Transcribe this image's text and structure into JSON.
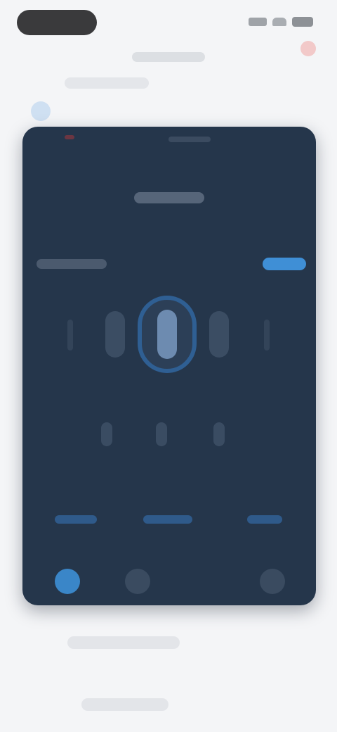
{
  "status_bar": {
    "icons": [
      "signal-icon",
      "wifi-icon",
      "battery-icon"
    ]
  },
  "header": {
    "title": "",
    "action_icon": "record-icon"
  },
  "sub_header": {
    "label": ""
  },
  "device_screen": {
    "title": "",
    "mode_left_label": "",
    "mode_right_label": "",
    "options": [
      "",
      "",
      ""
    ],
    "dock": [
      {
        "icon": "home-icon",
        "active": true
      },
      {
        "icon": "grid-icon",
        "active": false
      },
      {
        "icon": "settings-icon",
        "active": false
      }
    ]
  },
  "footer": {
    "caption": "",
    "caption_secondary": ""
  },
  "colors": {
    "card_background": "#25364b",
    "accent": "#3a86c8"
  }
}
